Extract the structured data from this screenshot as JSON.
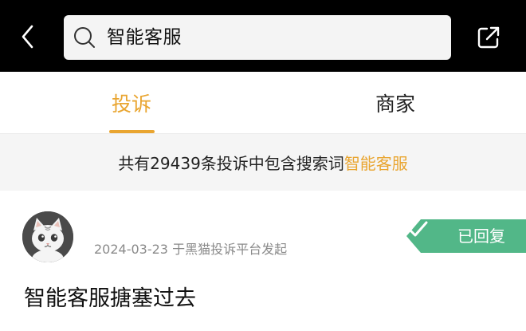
{
  "header": {
    "search_text": "智能客服",
    "icons": [
      "back-arrow-icon",
      "search-icon",
      "share-icon"
    ],
    "colors": {
      "bar": "#000000",
      "search_bg": "#f4f4f4"
    }
  },
  "tabs": [
    {
      "label": "投诉",
      "active": true
    },
    {
      "label": "商家",
      "active": false
    }
  ],
  "summary": {
    "prefix": "共有29439条投诉中包含搜索词",
    "keyword": "智能客服"
  },
  "result": {
    "avatar": "cat-avatar",
    "date": "2024-03-23",
    "source": "于黑猫投诉平台发起",
    "status": "已回复",
    "title": "智能客服搪塞过去"
  },
  "colors": {
    "accent": "#e9a530",
    "status_badge": "#52b788"
  }
}
